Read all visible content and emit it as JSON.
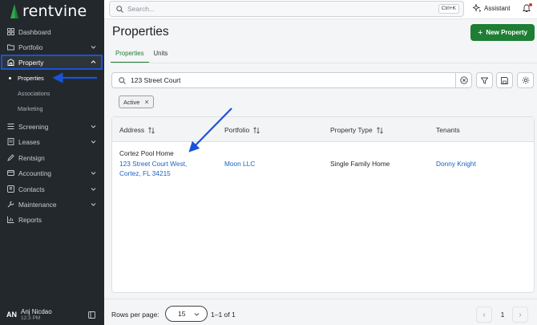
{
  "app": {
    "name": "rentvine"
  },
  "sidebar": {
    "items": [
      {
        "label": "Dashboard",
        "icon": "dashboard-icon",
        "chevron": false
      },
      {
        "label": "Portfolio",
        "icon": "folder-icon",
        "chevron": true
      },
      {
        "label": "Property",
        "icon": "building-icon",
        "chevron": true,
        "expanded": true
      },
      {
        "label": "Screening",
        "icon": "list-icon",
        "chevron": true
      },
      {
        "label": "Leases",
        "icon": "lease-icon",
        "chevron": true
      },
      {
        "label": "Rentsign",
        "icon": "pen-icon",
        "chevron": false
      },
      {
        "label": "Accounting",
        "icon": "accounting-icon",
        "chevron": true
      },
      {
        "label": "Contacts",
        "icon": "contacts-icon",
        "chevron": true
      },
      {
        "label": "Maintenance",
        "icon": "wrench-icon",
        "chevron": true
      },
      {
        "label": "Reports",
        "icon": "chart-icon",
        "chevron": false
      }
    ],
    "property_sub": [
      {
        "label": "Properties",
        "active": true
      },
      {
        "label": "Associations",
        "active": false
      },
      {
        "label": "Marketing",
        "active": false
      }
    ],
    "user": {
      "initials": "AN",
      "name": "Anj Nicdao",
      "time": "12:3 PM"
    }
  },
  "topbar": {
    "search_placeholder": "Search...",
    "shortcut": "Ctrl+K",
    "assistant_label": "Assistant"
  },
  "page": {
    "title": "Properties",
    "new_button": "New Property",
    "tabs": [
      {
        "label": "Properties",
        "active": true
      },
      {
        "label": "Units",
        "active": false
      }
    ],
    "search_value": "123 Street Court",
    "filter_chip": "Active"
  },
  "table": {
    "columns": [
      "Address",
      "Portfolio",
      "Property Type",
      "Tenants"
    ],
    "rows": [
      {
        "name": "Cortez Pool Home",
        "address_line1": "123 Street Court West,",
        "address_line2": "Cortez, FL 34215",
        "portfolio": "Moon LLC",
        "property_type": "Single Family Home",
        "tenants": "Donny Knight"
      }
    ]
  },
  "pagination": {
    "rows_per_page_label": "Rows per page:",
    "rows_per_page": "15",
    "range": "1–1 of 1",
    "current_page": "1"
  },
  "colors": {
    "sidebar_bg": "#23282c",
    "accent_green": "#1e7e34",
    "link_blue": "#1a63c4",
    "annotation_blue": "#1a53d9"
  }
}
